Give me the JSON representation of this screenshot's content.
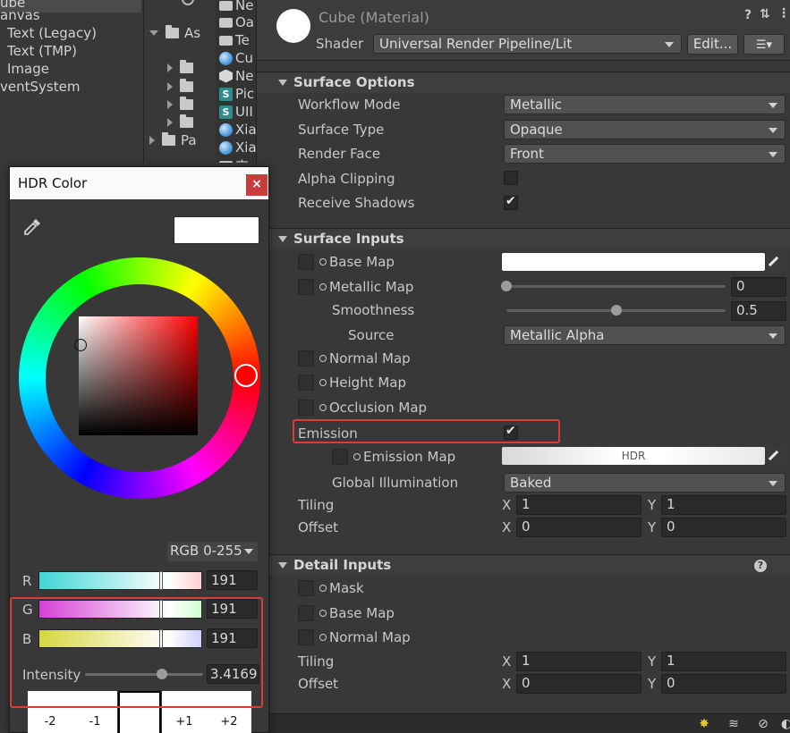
{
  "hierarchy": {
    "items": [
      "ube",
      "anvas",
      "Text (Legacy)",
      "Text (TMP)",
      "Image",
      "ventSystem"
    ]
  },
  "project": {
    "tree": [
      {
        "label": "As",
        "expanded": true
      },
      {
        "label": ""
      },
      {
        "label": ""
      },
      {
        "label": ""
      },
      {
        "label": ""
      },
      {
        "label": "Pa"
      }
    ],
    "files": [
      "Ne",
      "Oa",
      "Te",
      "Cu",
      "Ne",
      "Pic",
      "UII",
      "Xia",
      "Xia",
      "卒"
    ]
  },
  "inspector": {
    "material_title": "Cube (Material)",
    "shader_label": "Shader",
    "shader_value": "Universal Render Pipeline/Lit",
    "edit_label": "Edit...",
    "surface_options": {
      "title": "Surface Options",
      "workflow_mode": {
        "label": "Workflow Mode",
        "value": "Metallic"
      },
      "surface_type": {
        "label": "Surface Type",
        "value": "Opaque"
      },
      "render_face": {
        "label": "Render Face",
        "value": "Front"
      },
      "alpha_clipping": {
        "label": "Alpha Clipping",
        "checked": false
      },
      "receive_shadows": {
        "label": "Receive Shadows",
        "checked": true
      }
    },
    "surface_inputs": {
      "title": "Surface Inputs",
      "base_map": "Base Map",
      "metallic_map": {
        "label": "Metallic Map",
        "value": "0",
        "level": 0
      },
      "smoothness": {
        "label": "Smoothness",
        "value": "0.5",
        "level": 0.5
      },
      "source": {
        "label": "Source",
        "value": "Metallic Alpha"
      },
      "normal_map": "Normal Map",
      "height_map": "Height Map",
      "occlusion_map": "Occlusion Map",
      "emission": {
        "label": "Emission",
        "checked": true
      },
      "emission_map": {
        "label": "Emission Map",
        "hdr_label": "HDR"
      },
      "global_illumination": {
        "label": "Global Illumination",
        "value": "Baked"
      },
      "tiling": {
        "label": "Tiling",
        "x_label": "X",
        "x": "1",
        "y_label": "Y",
        "y": "1"
      },
      "offset": {
        "label": "Offset",
        "x_label": "X",
        "x": "0",
        "y_label": "Y",
        "y": "0"
      }
    },
    "detail_inputs": {
      "title": "Detail Inputs",
      "mask": "Mask",
      "base_map": "Base Map",
      "normal_map": "Normal Map",
      "tiling": {
        "label": "Tiling",
        "x_label": "X",
        "x": "1",
        "y_label": "Y",
        "y": "1"
      },
      "offset": {
        "label": "Offset",
        "x_label": "X",
        "x": "0",
        "y_label": "Y",
        "y": "0"
      }
    }
  },
  "hdr_color": {
    "title": "HDR Color",
    "close": "×",
    "mode": "RGB 0-255",
    "channels": [
      {
        "label": "R",
        "value": "191",
        "level": 0.749
      },
      {
        "label": "G",
        "value": "191",
        "level": 0.749
      },
      {
        "label": "B",
        "value": "191",
        "level": 0.749
      }
    ],
    "intensity": {
      "label": "Intensity",
      "value": "3.4169"
    },
    "swatch_labels": [
      "-2",
      "-1",
      "",
      "+1",
      "+2"
    ],
    "hue_color": "#ff0000",
    "current_color": "#ffffff"
  },
  "colors": {
    "highlight": "#e03a3a",
    "panel": "#383838"
  }
}
